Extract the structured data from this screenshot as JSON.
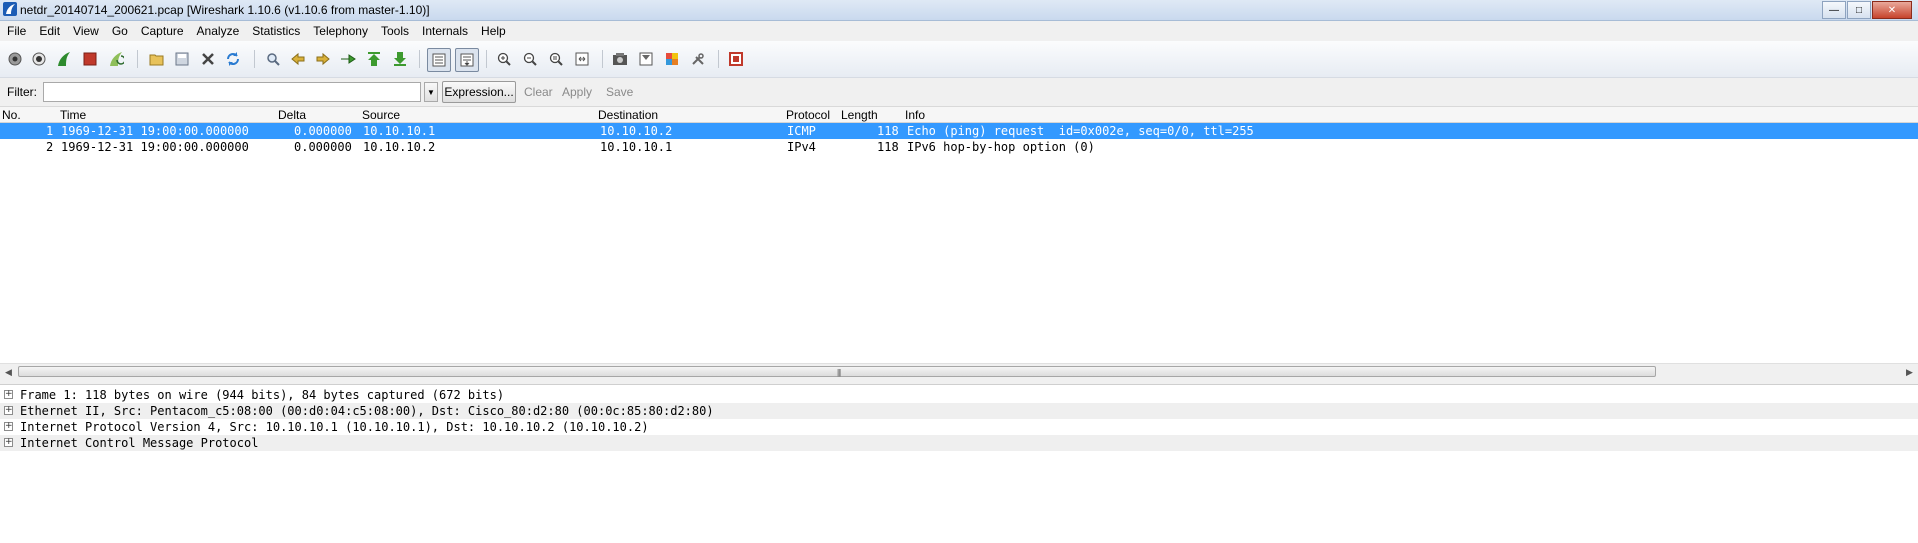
{
  "window": {
    "title": "netdr_20140714_200621.pcap   [Wireshark 1.10.6  (v1.10.6 from master-1.10)]"
  },
  "menu": [
    "File",
    "Edit",
    "View",
    "Go",
    "Capture",
    "Analyze",
    "Statistics",
    "Telephony",
    "Tools",
    "Internals",
    "Help"
  ],
  "filter": {
    "label": "Filter:",
    "value": "",
    "expression_label": "Expression...",
    "clear_label": "Clear",
    "apply_label": "Apply",
    "save_label": "Save"
  },
  "packet_list": {
    "columns": [
      "No.",
      "Time",
      "Delta",
      "Source",
      "Destination",
      "Protocol",
      "Length",
      "Info"
    ],
    "rows": [
      {
        "no": "1",
        "time": "1969-12-31 19:00:00.000000",
        "delta": "0.000000",
        "source": "10.10.10.1",
        "destination": "10.10.10.2",
        "protocol": "ICMP",
        "length": "118",
        "info": "Echo (ping) request  id=0x002e, seq=0/0, ttl=255",
        "selected": true
      },
      {
        "no": "2",
        "time": "1969-12-31 19:00:00.000000",
        "delta": "0.000000",
        "source": "10.10.10.2",
        "destination": "10.10.10.1",
        "protocol": "IPv4",
        "length": "118",
        "info": "IPv6 hop-by-hop option (0)",
        "selected": false
      }
    ]
  },
  "packet_details": [
    "Frame 1: 118 bytes on wire (944 bits), 84 bytes captured (672 bits)",
    "Ethernet II, Src: Pentacom_c5:08:00 (00:d0:04:c5:08:00), Dst: Cisco_80:d2:80 (00:0c:85:80:d2:80)",
    "Internet Protocol Version 4, Src: 10.10.10.1 (10.10.10.1), Dst: 10.10.10.2 (10.10.10.2)",
    "Internet Control Message Protocol"
  ],
  "colors": {
    "selection": "#3399ff",
    "accent_green": "#2e8b2e",
    "accent_red": "#cc3b2b"
  }
}
